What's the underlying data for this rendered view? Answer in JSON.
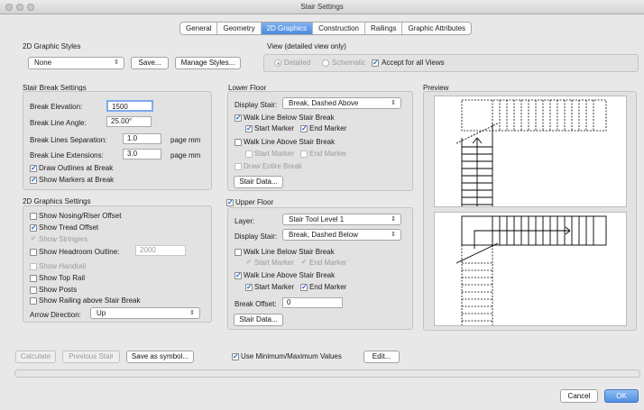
{
  "window": {
    "title": "Stair Settings"
  },
  "tabs": [
    {
      "label": "General"
    },
    {
      "label": "Geometry"
    },
    {
      "label": "2D Graphics"
    },
    {
      "label": "Construction"
    },
    {
      "label": "Railings"
    },
    {
      "label": "Graphic Attributes"
    }
  ],
  "styles": {
    "heading": "2D Graphic Styles",
    "value": "None",
    "save_label": "Save...",
    "manage_label": "Manage Styles..."
  },
  "view": {
    "heading": "View (detailed view only)",
    "detailed": "Detailed",
    "schematic": "Schematic",
    "accept": "Accept for all Views"
  },
  "stair_break": {
    "heading": "Stair Break Settings",
    "elevation_label": "Break Elevation:",
    "elevation_value": "1500",
    "angle_label": "Break Line Angle:",
    "angle_value": "25.00°",
    "separation_label": "Break Lines Separation:",
    "separation_value": "1.0",
    "separation_unit": "page mm",
    "extensions_label": "Break Line Extensions:",
    "extensions_value": "3.0",
    "extensions_unit": "page mm",
    "draw_outlines": "Draw Outlines at Break",
    "show_markers": "Show Markers at Break"
  },
  "graphics": {
    "heading": "2D Graphics Settings",
    "nosing": "Show Nosing/Riser Offset",
    "tread": "Show Tread Offset",
    "stringers": "Show Stringers",
    "headroom": "Show Headroom Outline:",
    "headroom_value": "2000",
    "handrail": "Show Handrail",
    "top_rail": "Show Top Rail",
    "posts": "Show Posts",
    "railing_above": "Show Railing above Stair Break",
    "arrow_label": "Arrow Direction:",
    "arrow_value": "Up"
  },
  "lower": {
    "heading": "Lower Floor",
    "display_label": "Display Stair:",
    "display_value": "Break, Dashed Above",
    "walk_below": "Walk Line Below Stair Break",
    "start_marker": "Start Marker",
    "end_marker": "End Marker",
    "walk_above": "Walk Line Above Stair Break",
    "start_marker2": "Start Marker",
    "end_marker2": "End Marker",
    "draw_entire": "Draw Entire Break",
    "stair_data": "Stair Data..."
  },
  "upper": {
    "heading": "Upper Floor",
    "layer_label": "Layer:",
    "layer_value": "Stair Tool Level 1",
    "display_label": "Display Stair:",
    "display_value": "Break, Dashed Below",
    "walk_below": "Walk Line Below Stair Break",
    "start_marker": "Start Marker",
    "end_marker": "End Marker",
    "walk_above": "Walk Line Above Stair Break",
    "start_marker2": "Start Marker",
    "end_marker2": "End Marker",
    "offset_label": "Break Offset:",
    "offset_value": "0",
    "stair_data": "Stair Data..."
  },
  "preview": {
    "heading": "Preview"
  },
  "footer": {
    "calculate": "Calculate",
    "previous": "Previous Stair",
    "save_symbol": "Save as symbol...",
    "minmax": "Use Minimum/Maximum Values",
    "edit": "Edit...",
    "cancel": "Cancel",
    "ok": "OK"
  },
  "icons": {
    "check": "✓",
    "updown": "⇕"
  }
}
